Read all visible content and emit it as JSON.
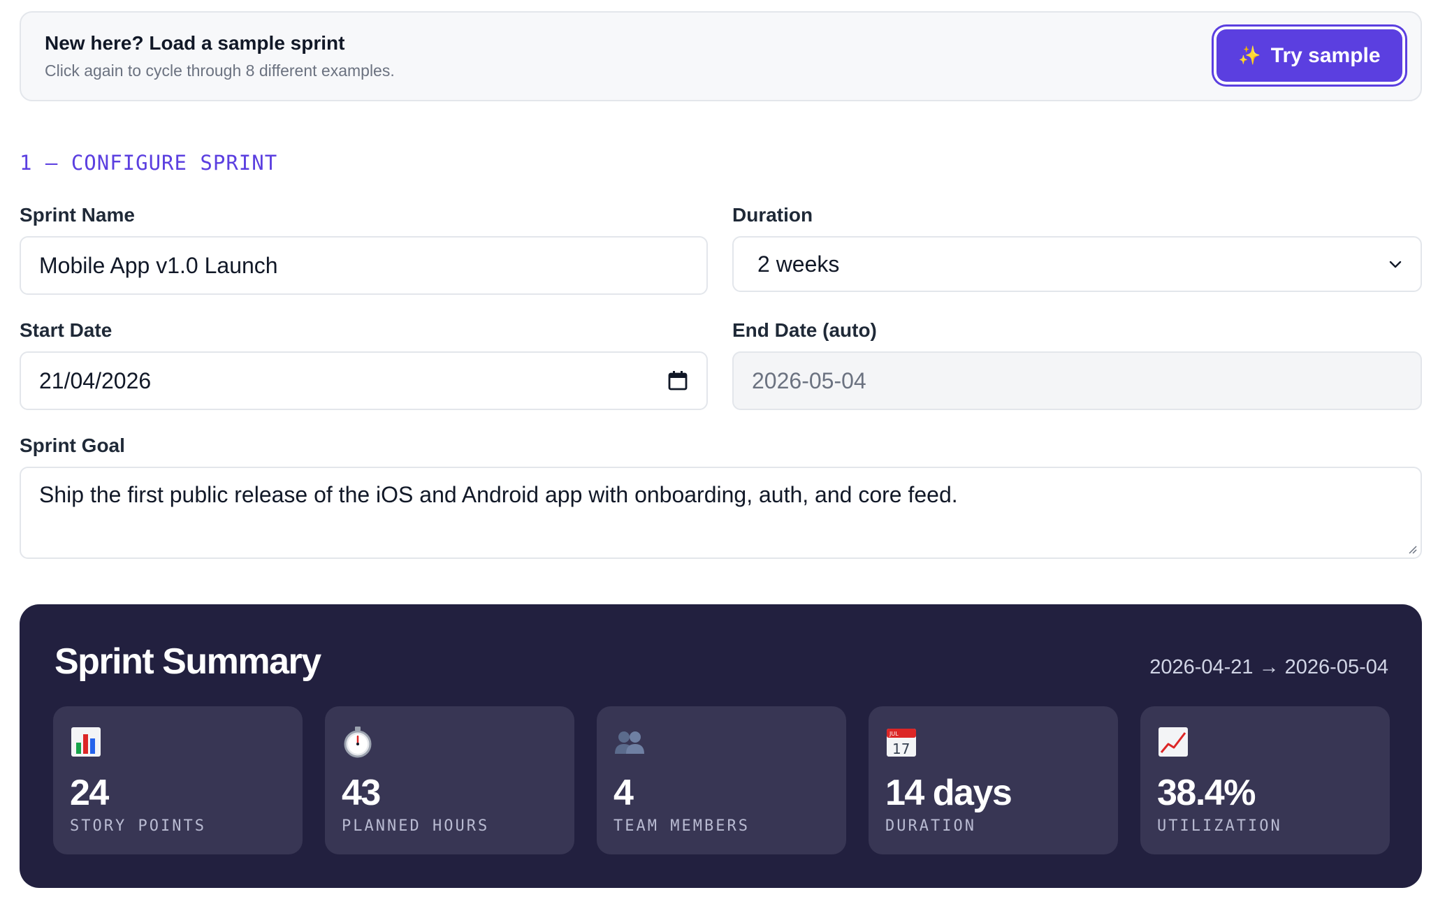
{
  "banner": {
    "title": "New here? Load a sample sprint",
    "subtitle": "Click again to cycle through 8 different examples.",
    "button_icon": "sparkle-icon",
    "button_label": "Try sample"
  },
  "section": {
    "heading": "1 — CONFIGURE SPRINT"
  },
  "form": {
    "sprint_name": {
      "label": "Sprint Name",
      "value": "Mobile App v1.0 Launch"
    },
    "duration": {
      "label": "Duration",
      "value": "2 weeks"
    },
    "start_date": {
      "label": "Start Date",
      "value": "21/04/2026"
    },
    "end_date": {
      "label": "End Date (auto)",
      "value": "2026-05-04"
    },
    "goal": {
      "label": "Sprint Goal",
      "value": "Ship the first public release of the iOS and Android app with onboarding, auth, and core feed."
    }
  },
  "summary": {
    "title": "Sprint Summary",
    "range": "2026-04-21 → 2026-05-04",
    "stats": [
      {
        "icon": "bar-chart-icon",
        "value": "24",
        "label": "Story Points"
      },
      {
        "icon": "stopwatch-icon",
        "value": "43",
        "label": "Planned Hours"
      },
      {
        "icon": "team-icon",
        "value": "4",
        "label": "Team Members"
      },
      {
        "icon": "calendar-icon",
        "value": "14 days",
        "label": "Duration",
        "calendar_month": "JUL",
        "calendar_day": "17"
      },
      {
        "icon": "trend-up-icon",
        "value": "38.4%",
        "label": "Utilization"
      }
    ]
  },
  "colors": {
    "accent": "#5b3fe0",
    "summary_bg": "#22203f",
    "stat_bg": "#383654"
  }
}
